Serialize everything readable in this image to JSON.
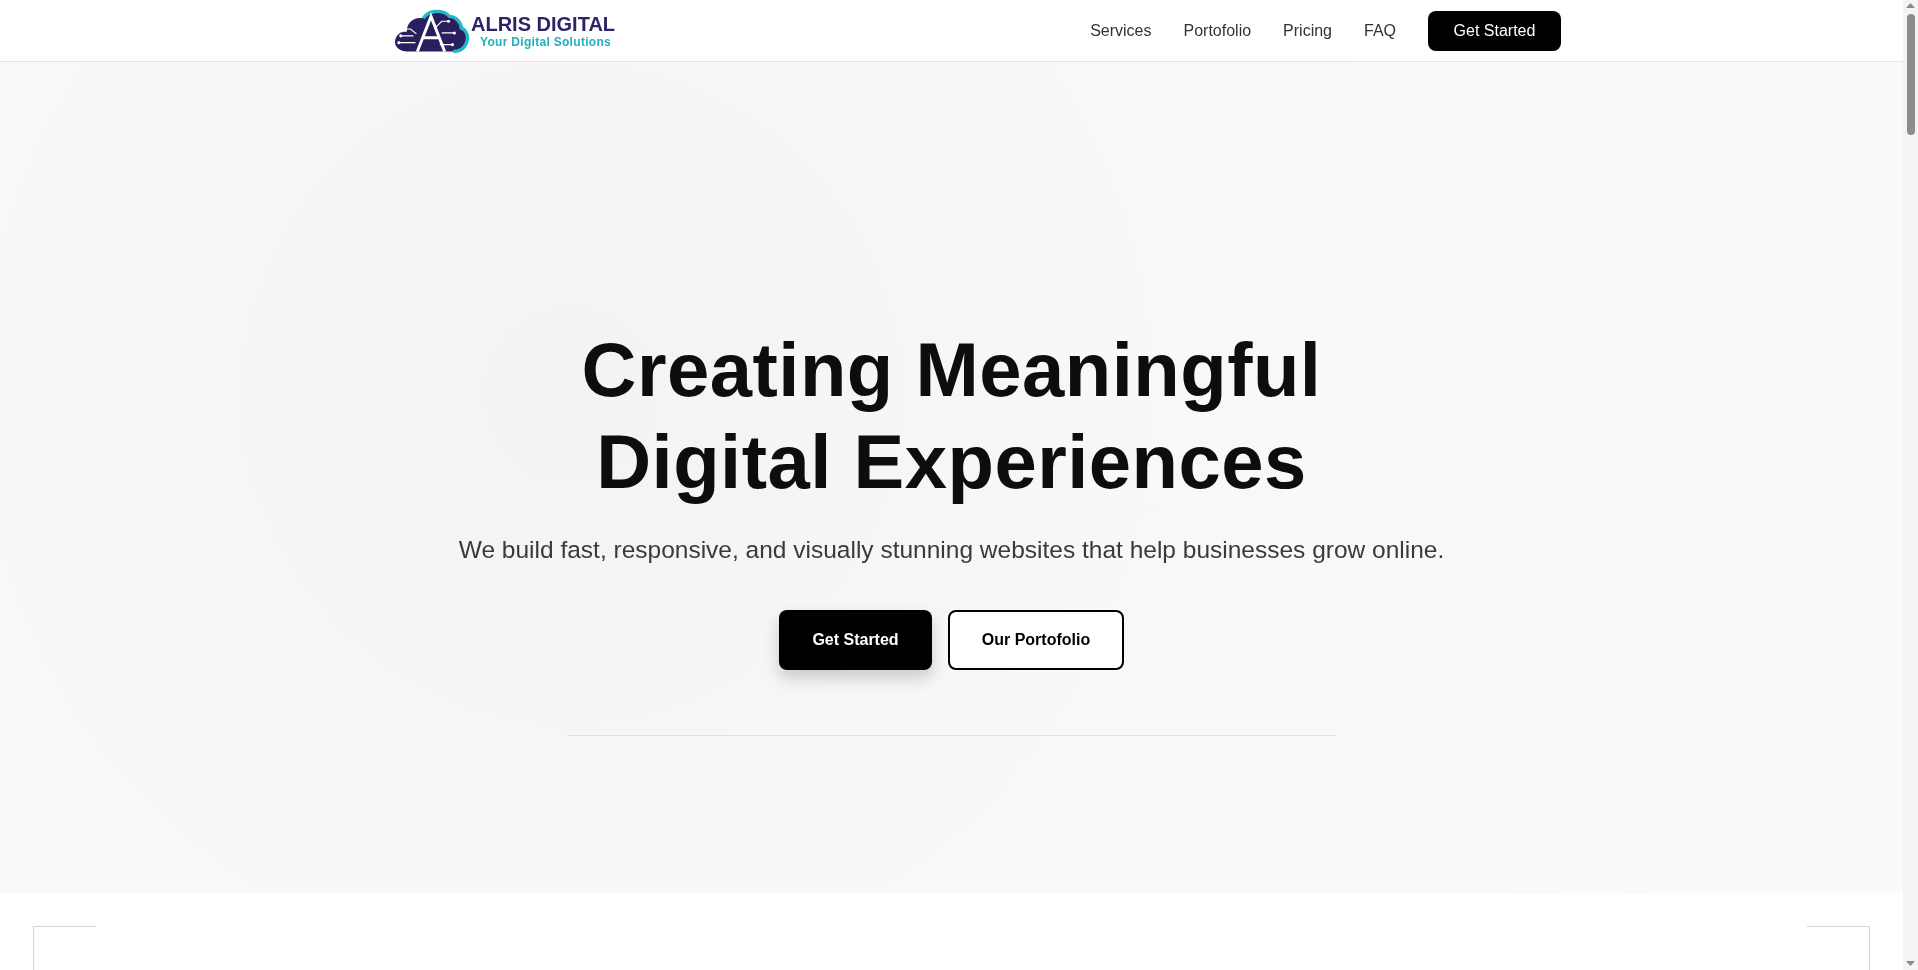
{
  "header": {
    "logo": {
      "name": "ALRIS DIGITAL",
      "tagline": "Your Digital Solutions"
    },
    "nav": [
      "Services",
      "Portofolio",
      "Pricing",
      "FAQ"
    ],
    "cta": "Get Started"
  },
  "hero": {
    "title": "Creating Meaningful Digital Experiences",
    "subtitle": "We build fast, responsive, and visually stunning websites that help businesses grow online.",
    "buttons": [
      {
        "label": "Get Started",
        "kind": "primary"
      },
      {
        "label": "Our Portofolio",
        "kind": "outline"
      }
    ]
  }
}
